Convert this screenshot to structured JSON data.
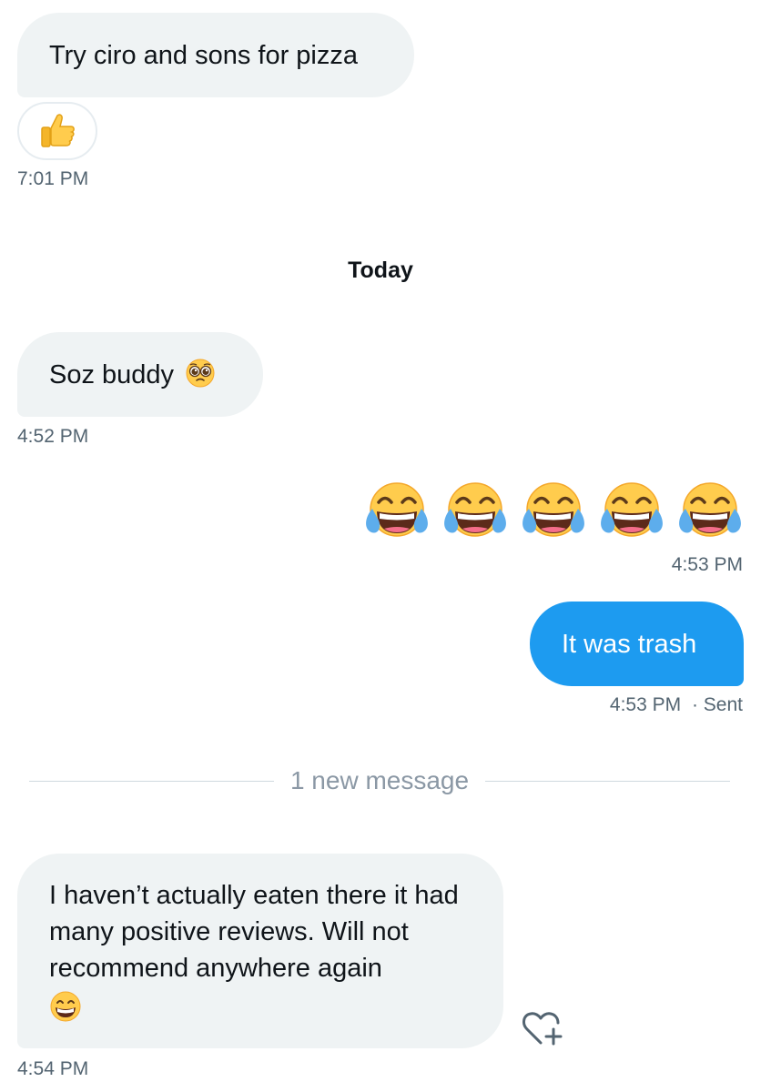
{
  "conversation": {
    "messages": [
      {
        "direction": "incoming",
        "text": "Try ciro and sons for pizza",
        "reaction_icon": "thumbs-up-emoji",
        "time": "7:01 PM"
      },
      {
        "direction": "incoming",
        "text": "Soz buddy",
        "emoji": "pleading-face-emoji",
        "time": "4:52 PM"
      },
      {
        "direction": "outgoing",
        "emoji": "tears-of-joy-emoji",
        "emoji_count": 5,
        "time": "4:53 PM"
      },
      {
        "direction": "outgoing",
        "text": "It was trash",
        "time": "4:53 PM",
        "status": "· Sent"
      },
      {
        "direction": "incoming",
        "text": "I haven’t actually eaten there it had many positive reviews. Will not recommend anywhere again",
        "emoji": "beaming-grin-emoji",
        "time": "4:54 PM"
      }
    ],
    "day_separator": "Today",
    "new_messages_divider": "1 new message",
    "add_reaction_icon": "heart-plus-icon"
  },
  "colors": {
    "incoming_bubble": "#eff3f4",
    "outgoing_bubble": "#1d9bf0",
    "timestamp": "#536471",
    "divider_text": "#8b98a5"
  }
}
